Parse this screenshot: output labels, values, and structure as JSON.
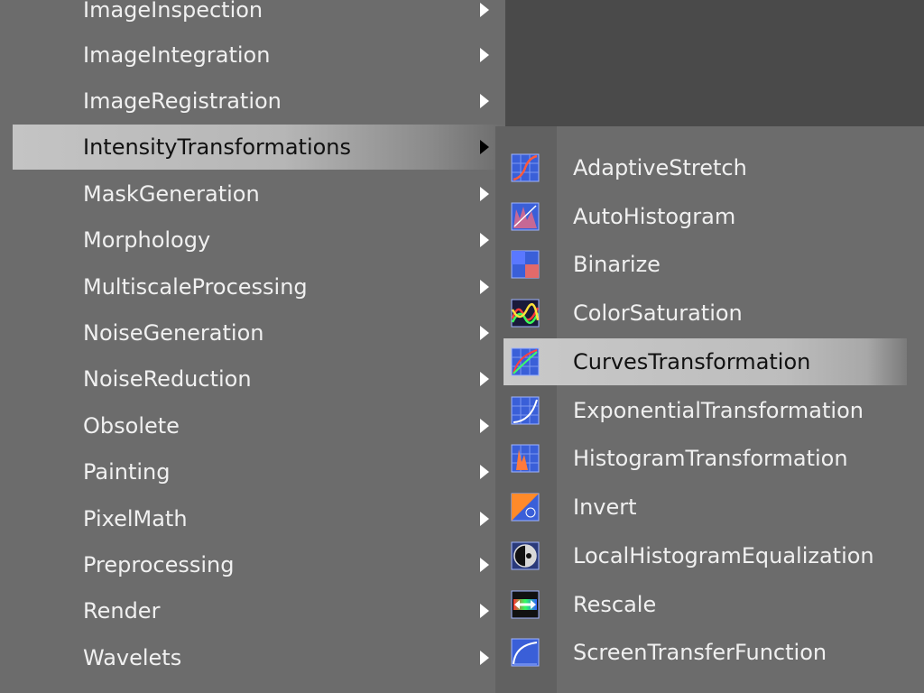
{
  "menu": {
    "items": [
      {
        "label": "ImageInspection"
      },
      {
        "label": "ImageIntegration"
      },
      {
        "label": "ImageRegistration"
      },
      {
        "label": "IntensityTransformations",
        "active": true
      },
      {
        "label": "MaskGeneration"
      },
      {
        "label": "Morphology"
      },
      {
        "label": "MultiscaleProcessing"
      },
      {
        "label": "NoiseGeneration"
      },
      {
        "label": "NoiseReduction"
      },
      {
        "label": "Obsolete"
      },
      {
        "label": "Painting"
      },
      {
        "label": "PixelMath"
      },
      {
        "label": "Preprocessing"
      },
      {
        "label": "Render"
      },
      {
        "label": "Wavelets"
      }
    ]
  },
  "submenu": {
    "items": [
      {
        "label": "AdaptiveStretch",
        "icon": "adaptive-stretch-icon"
      },
      {
        "label": "AutoHistogram",
        "icon": "auto-histogram-icon"
      },
      {
        "label": "Binarize",
        "icon": "binarize-icon"
      },
      {
        "label": "ColorSaturation",
        "icon": "color-saturation-icon"
      },
      {
        "label": "CurvesTransformation",
        "icon": "curves-transformation-icon",
        "hover": true
      },
      {
        "label": "ExponentialTransformation",
        "icon": "exponential-transformation-icon"
      },
      {
        "label": "HistogramTransformation",
        "icon": "histogram-transformation-icon"
      },
      {
        "label": "Invert",
        "icon": "invert-icon"
      },
      {
        "label": "LocalHistogramEqualization",
        "icon": "local-histogram-equalization-icon"
      },
      {
        "label": "Rescale",
        "icon": "rescale-icon"
      },
      {
        "label": "ScreenTransferFunction",
        "icon": "screen-transfer-function-icon"
      }
    ]
  },
  "colors": {
    "menu_background": "#6c6c6c",
    "menu_text": "#f0f0f0",
    "highlight_text": "#111111",
    "highlight": "#c4c4c4",
    "workspace": "#4a4a4a",
    "icon_blue": "#3a5fd8"
  }
}
